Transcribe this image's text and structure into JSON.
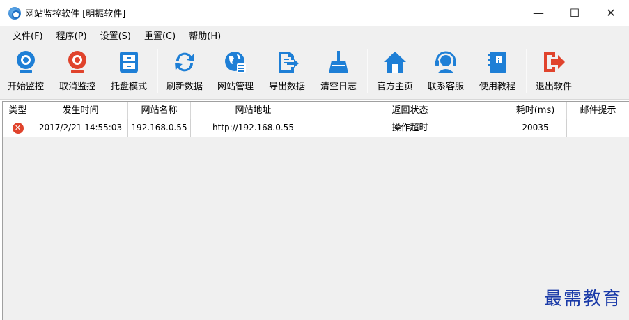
{
  "window": {
    "title": "网站监控软件 [明振软件]",
    "minimize_glyph": "—",
    "maximize_glyph": "☐",
    "close_glyph": "✕"
  },
  "menu": [
    "文件(F)",
    "程序(P)",
    "设置(S)",
    "重置(C)",
    "帮助(H)"
  ],
  "toolbar": [
    {
      "label": "开始监控",
      "icon": "webcam-icon"
    },
    {
      "label": "取消监控",
      "icon": "webcam-off-icon"
    },
    {
      "label": "托盘模式",
      "icon": "tray-icon"
    },
    {
      "label": "刷新数据",
      "icon": "refresh-icon"
    },
    {
      "label": "网站管理",
      "icon": "globe-icon"
    },
    {
      "label": "导出数据",
      "icon": "export-icon"
    },
    {
      "label": "清空日志",
      "icon": "broom-icon"
    },
    {
      "label": "官方主页",
      "icon": "home-icon"
    },
    {
      "label": "联系客服",
      "icon": "headset-icon"
    },
    {
      "label": "使用教程",
      "icon": "book-icon"
    },
    {
      "label": "退出软件",
      "icon": "exit-icon"
    }
  ],
  "columns": [
    "类型",
    "发生时间",
    "网站名称",
    "网站地址",
    "返回状态",
    "耗时(ms)",
    "邮件提示"
  ],
  "rows": [
    {
      "type_icon": "error-icon",
      "time": "2017/2/21 14:55:03",
      "name": "192.168.0.55",
      "url": "http://192.168.0.55",
      "status": "操作超时",
      "elapsed": "20035",
      "mail": ""
    }
  ],
  "colors": {
    "accent_blue": "#1e7fd6",
    "accent_red": "#e0432c",
    "watermark": "#1a3aa8"
  },
  "watermark": "最需教育"
}
